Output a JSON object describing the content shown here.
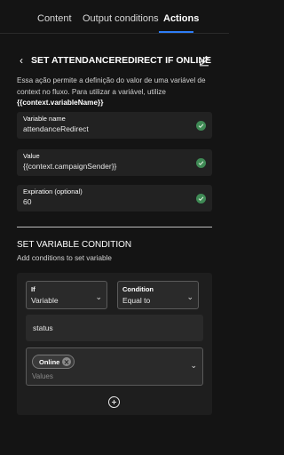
{
  "tabs": [
    {
      "label": "Content",
      "active": false
    },
    {
      "label": "Output conditions",
      "active": false
    },
    {
      "label": "Actions",
      "active": true
    }
  ],
  "colors": {
    "accent": "#2e7cf6",
    "valid": "#3f8a55",
    "background": "#141414"
  },
  "action": {
    "title": "SET ATTENDANCEREDIRECT IF ONLINE",
    "back_icon": "chevron-left-icon",
    "edit_icon": "pencil-icon",
    "description": "Essa ação permite a definição do valor de uma variável de context no fluxo. Para utilizar a variável, utilize",
    "variable_syntax": "{{context.variableName}}"
  },
  "fields": {
    "variable_name": {
      "label": "Variable name",
      "value": "attendanceRedirect",
      "valid": true
    },
    "value": {
      "label": "Value",
      "value": "{{context.campaignSender}}",
      "valid": true
    },
    "expiration": {
      "label": "Expiration (optional)",
      "value": "60",
      "valid": true
    }
  },
  "variable_condition": {
    "title": "SET VARIABLE CONDITION",
    "subtitle": "Add conditions to set variable",
    "if_select": {
      "label": "If",
      "value": "Variable"
    },
    "condition_select": {
      "label": "Condition",
      "value": "Equal to"
    },
    "attribute": "status",
    "values": {
      "chips": [
        "Online"
      ],
      "placeholder": "Values"
    },
    "add_icon": "plus-circle-icon"
  }
}
